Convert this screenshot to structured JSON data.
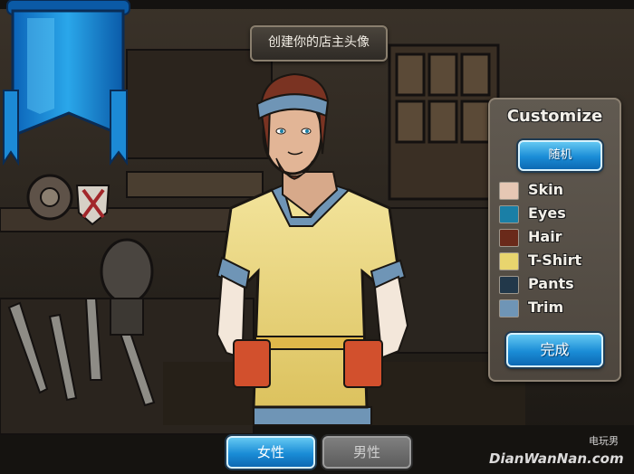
{
  "header": {
    "title": "创建你的店主头像"
  },
  "customize": {
    "title": "Customize",
    "random_label": "随机",
    "done_label": "完成",
    "options": [
      {
        "label": "Skin",
        "color": "#e6c7b4"
      },
      {
        "label": "Eyes",
        "color": "#1a7fa6"
      },
      {
        "label": "Hair",
        "color": "#6a2a1a"
      },
      {
        "label": "T-Shirt",
        "color": "#e8d56e"
      },
      {
        "label": "Pants",
        "color": "#22384a"
      },
      {
        "label": "Trim",
        "color": "#6f95b6"
      }
    ]
  },
  "gender": {
    "female_label": "女性",
    "male_label": "男性"
  },
  "watermark": {
    "text": "DianWanNan.com",
    "cn": "电玩男"
  },
  "colors": {
    "accent_blue": "#1a8cd6",
    "banner_blue": "#2aa7ea"
  },
  "icons": {
    "banner": "blue-pennant-banner"
  }
}
